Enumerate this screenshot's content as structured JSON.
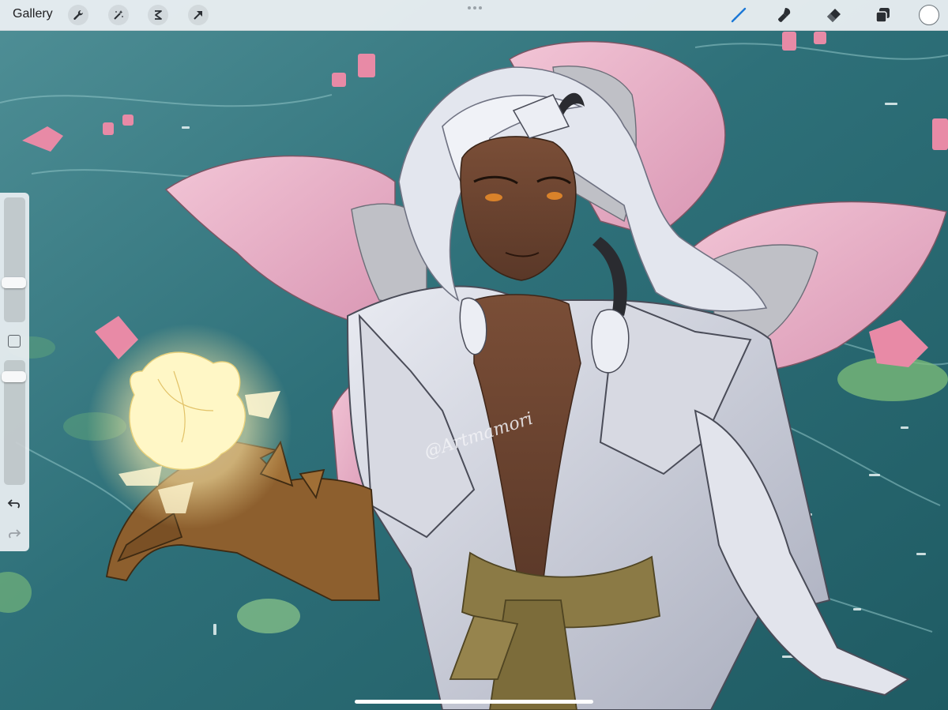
{
  "app": {
    "gallery_label": "Gallery"
  },
  "toolbar_left": {
    "icons": [
      "wrench-icon",
      "magic-wand-icon",
      "selection-icon",
      "transform-arrow-icon"
    ]
  },
  "toolbar_right": {
    "icons": [
      "brush-icon",
      "smudge-icon",
      "eraser-icon",
      "layers-icon"
    ],
    "active_tool": "brush",
    "active_color": "#1b78d6",
    "current_color": "#ffffff"
  },
  "sidebar": {
    "brush_size_level": 0.3,
    "opacity_level": 0.9,
    "undo_icon": "undo-icon",
    "redo_icon": "redo-icon",
    "modify_icon": "modify-square-icon"
  },
  "artwork": {
    "signature": "@Artmamori"
  },
  "colors": {
    "water": "#2f7078",
    "petal": "#e8b4c9",
    "skin": "#6b4430",
    "hair": "#e3e6ee",
    "armor": "#c9ccd8",
    "sash": "#8b7a45",
    "glow": "#fff4b8"
  }
}
